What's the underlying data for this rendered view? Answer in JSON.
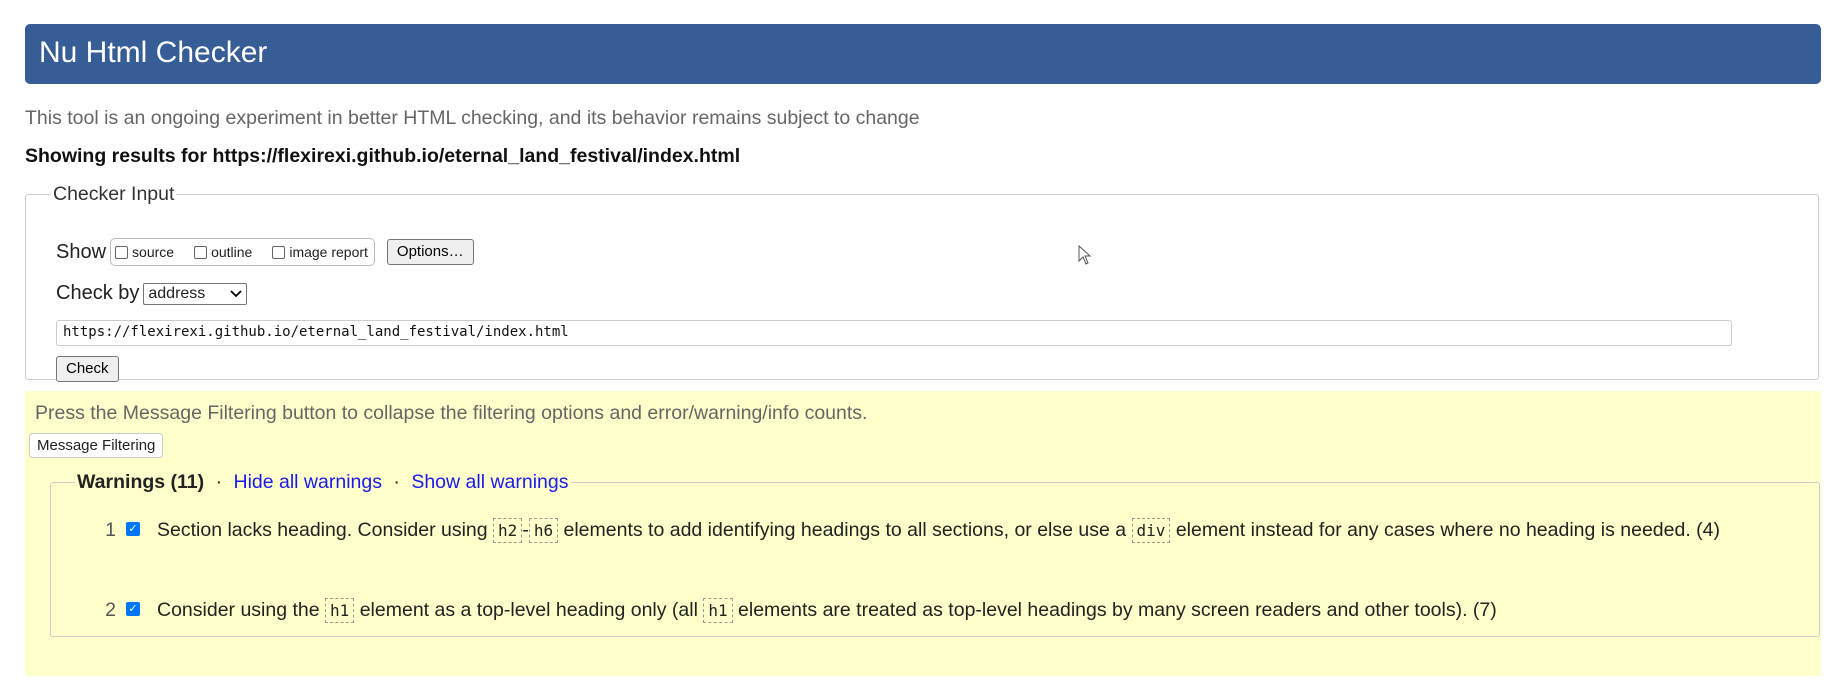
{
  "header": {
    "title": "Nu Html Checker"
  },
  "intro": "This tool is an ongoing experiment in better HTML checking, and its behavior remains subject to change",
  "results": {
    "prefix": "Showing results for",
    "url": "https://flexirexi.github.io/eternal_land_festival/index.html"
  },
  "checker_input": {
    "legend": "Checker Input",
    "show_label": "Show",
    "options": [
      {
        "label": "source",
        "checked": false
      },
      {
        "label": "outline",
        "checked": false
      },
      {
        "label": "image report",
        "checked": false
      }
    ],
    "options_button": "Options…",
    "check_by_label": "Check by",
    "check_by_value": "address",
    "address_value": "https://flexirexi.github.io/eternal_land_festival/index.html",
    "check_button": "Check"
  },
  "filtering": {
    "text": "Press the Message Filtering button to collapse the filtering options and error/warning/info counts.",
    "button": "Message Filtering"
  },
  "warnings": {
    "title": "Warnings (11)",
    "separator": "·",
    "hide_all": "Hide all warnings",
    "show_all": "Show all warnings",
    "items": [
      {
        "number": "1",
        "text_a": "Section lacks heading. Consider using ",
        "code_a": "h2",
        "dash": "-",
        "code_b": "h6",
        "text_b": " elements to add identifying headings to all sections, or else use a ",
        "code_c": "div",
        "text_c": " element instead for any cases where no heading is needed. (4)"
      },
      {
        "number": "2",
        "text_a": "Consider using the ",
        "code_a": "h1",
        "text_b": " element as a top-level heading only (all ",
        "code_b": "h1",
        "text_c": " elements are treated as top-level headings by many screen readers and other tools). (7)"
      }
    ]
  },
  "colors": {
    "header_bg": "#365d95",
    "filter_bg": "#ffffcc",
    "link": "#1a1aee"
  }
}
